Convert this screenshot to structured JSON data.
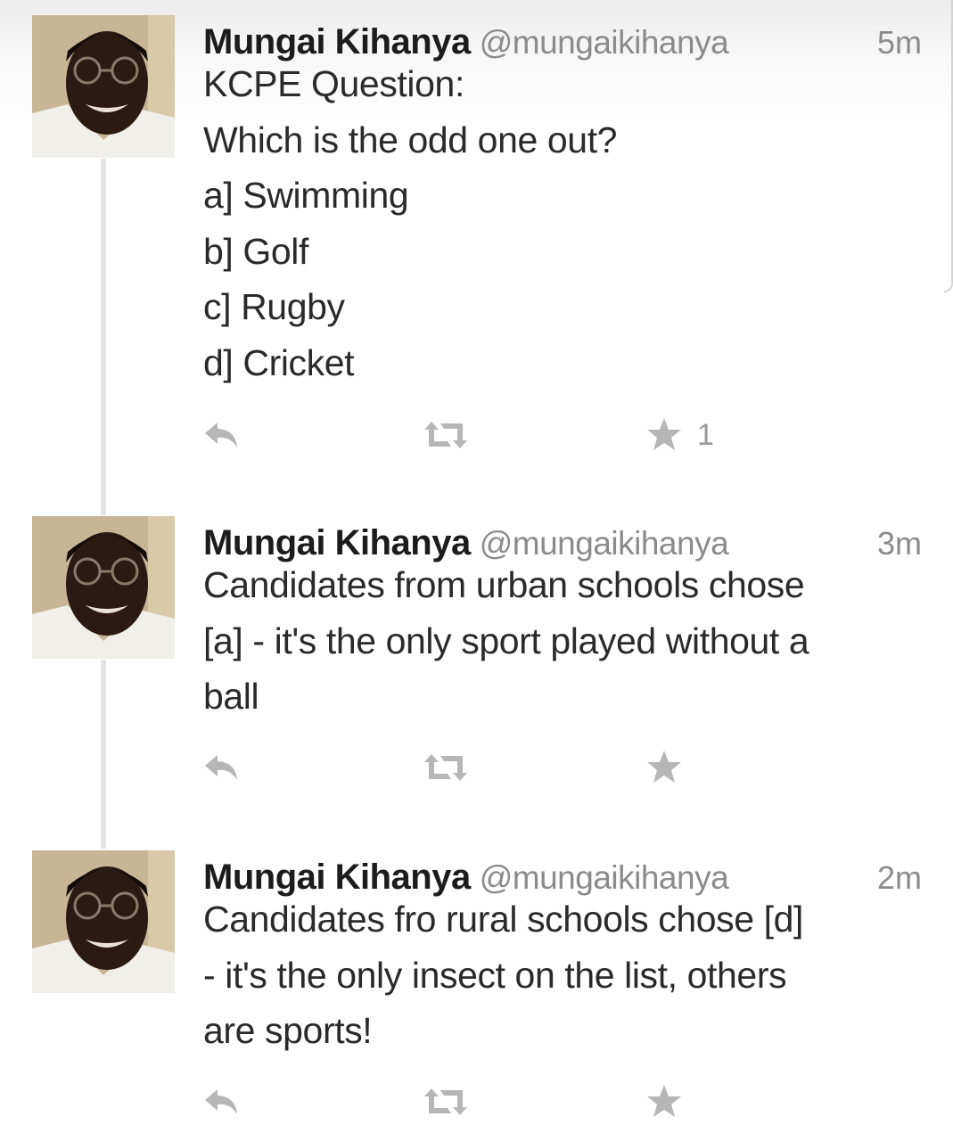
{
  "tweets": [
    {
      "author_name": "Mungai Kihanya",
      "handle": "@mungaikihanya",
      "time": "5m",
      "lines": [
        "KCPE Question:",
        "Which is the odd one out?",
        "a] Swimming",
        "b] Golf",
        "c] Rugby",
        "d] Cricket"
      ],
      "favorites": "1"
    },
    {
      "author_name": "Mungai Kihanya",
      "handle": "@mungaikihanya",
      "time": "3m",
      "lines": [
        "Candidates from urban schools chose",
        "[a] - it's the only sport played without a",
        "ball"
      ],
      "favorites": ""
    },
    {
      "author_name": "Mungai Kihanya",
      "handle": "@mungaikihanya",
      "time": "2m",
      "lines": [
        "Candidates fro rural schools chose [d]",
        "- it's the only insect on the list, others",
        "are sports!"
      ],
      "favorites": ""
    }
  ],
  "icons": {
    "reply": "reply-arrow-icon",
    "retweet": "retweet-icon",
    "favorite": "star-icon"
  },
  "colors": {
    "name": "#1c1c1c",
    "meta": "#8b8b8b",
    "text": "#2a2a2a",
    "action_icon": "#b6b6b6"
  }
}
